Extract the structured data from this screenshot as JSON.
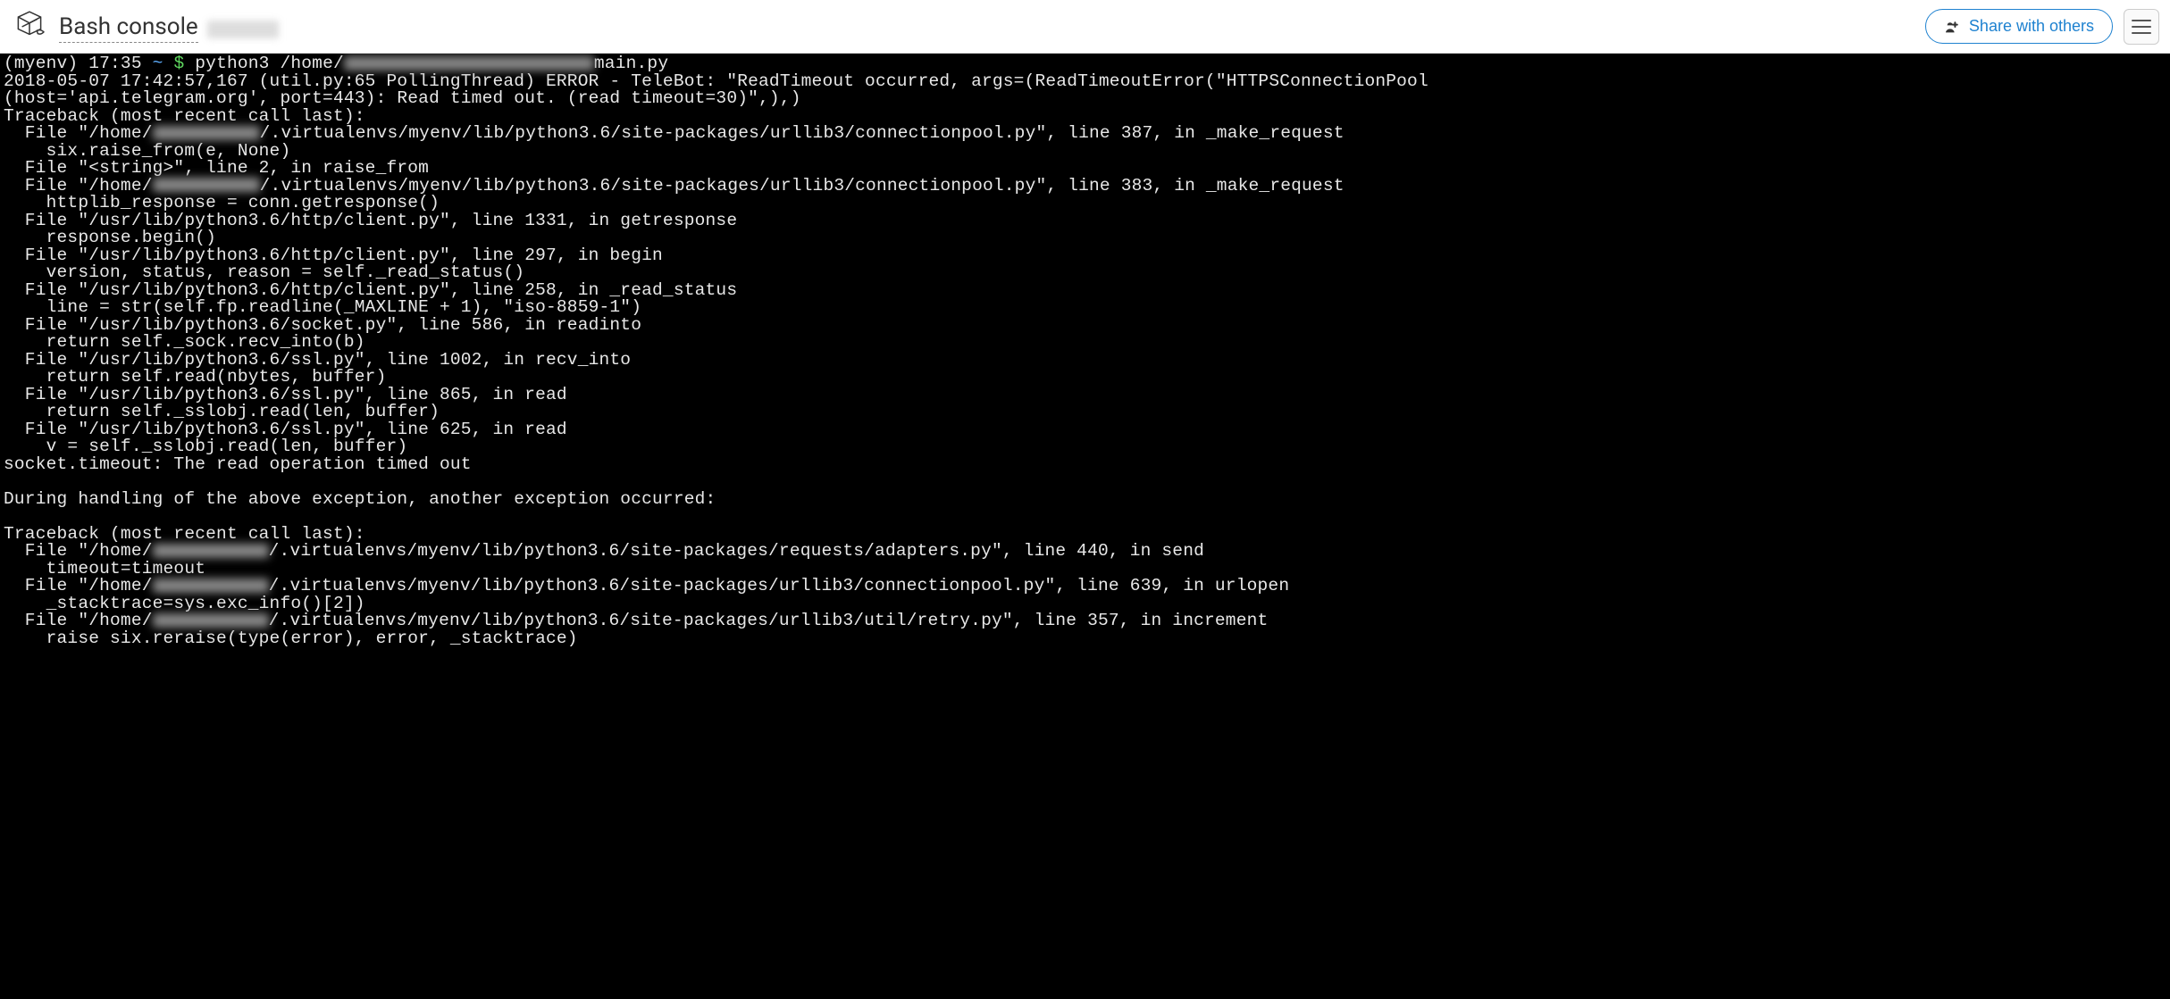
{
  "header": {
    "title": "Bash console",
    "share_label": "Share with others"
  },
  "console": {
    "prompt": {
      "env": "(myenv) 17:35 ",
      "tilde": "~ ",
      "dollar": "$ ",
      "cmd_before": "python3 /home/",
      "cmd_after": "main.py"
    },
    "lines": [
      "2018-05-07 17:42:57,167 (util.py:65 PollingThread) ERROR - TeleBot: \"ReadTimeout occurred, args=(ReadTimeoutError(\"HTTPSConnectionPool",
      "(host='api.telegram.org', port=443): Read timed out. (read timeout=30)\",),)",
      "Traceback (most recent call last):"
    ],
    "file1_before": "  File \"/home/",
    "file1_after": "/.virtualenvs/myenv/lib/python3.6/site-packages/urllib3/connectionpool.py\", line 387, in _make_request",
    "line2": "    six.raise_from(e, None)",
    "line3": "  File \"<string>\", line 2, in raise_from",
    "file2_before": "  File \"/home/",
    "file2_after": "/.virtualenvs/myenv/lib/python3.6/site-packages/urllib3/connectionpool.py\", line 383, in _make_request",
    "line5": "    httplib_response = conn.getresponse()",
    "line6": "  File \"/usr/lib/python3.6/http/client.py\", line 1331, in getresponse",
    "line7": "    response.begin()",
    "line8": "  File \"/usr/lib/python3.6/http/client.py\", line 297, in begin",
    "line9": "    version, status, reason = self._read_status()",
    "line10": "  File \"/usr/lib/python3.6/http/client.py\", line 258, in _read_status",
    "line11": "    line = str(self.fp.readline(_MAXLINE + 1), \"iso-8859-1\")",
    "line12": "  File \"/usr/lib/python3.6/socket.py\", line 586, in readinto",
    "line13": "    return self._sock.recv_into(b)",
    "line14": "  File \"/usr/lib/python3.6/ssl.py\", line 1002, in recv_into",
    "line15": "    return self.read(nbytes, buffer)",
    "line16": "  File \"/usr/lib/python3.6/ssl.py\", line 865, in read",
    "line17": "    return self._sslobj.read(len, buffer)",
    "line18": "  File \"/usr/lib/python3.6/ssl.py\", line 625, in read",
    "line19": "    v = self._sslobj.read(len, buffer)",
    "line20": "socket.timeout: The read operation timed out",
    "line21": "",
    "line22": "During handling of the above exception, another exception occurred:",
    "line23": "",
    "line24": "Traceback (most recent call last):",
    "file3_before": "  File \"/home/",
    "file3_after": "/.virtualenvs/myenv/lib/python3.6/site-packages/requests/adapters.py\", line 440, in send",
    "line26": "    timeout=timeout",
    "file4_before": "  File \"/home/",
    "file4_after": "/.virtualenvs/myenv/lib/python3.6/site-packages/urllib3/connectionpool.py\", line 639, in urlopen",
    "line28": "    _stacktrace=sys.exc_info()[2])",
    "file5_before": "  File \"/home/",
    "file5_after": "/.virtualenvs/myenv/lib/python3.6/site-packages/urllib3/util/retry.py\", line 357, in increment",
    "line30": "    raise six.reraise(type(error), error, _stacktrace)"
  }
}
